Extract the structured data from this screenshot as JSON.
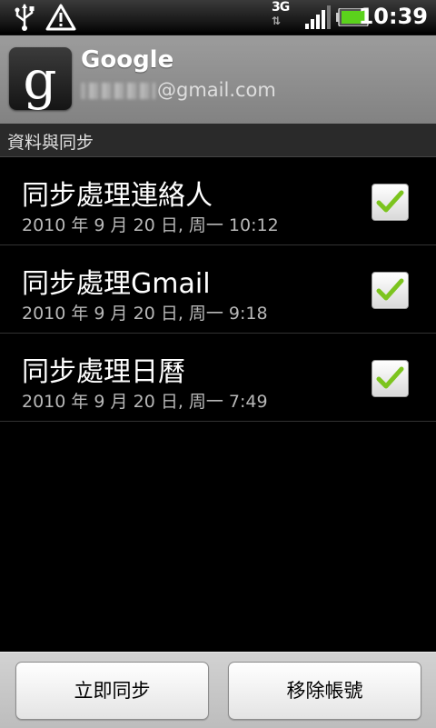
{
  "status_bar": {
    "time": "10:39",
    "network": "3G",
    "icons": [
      "usb-icon",
      "warning-icon",
      "signal-icon",
      "battery-icon"
    ]
  },
  "account": {
    "name": "Google",
    "email_visible": "@gmail.com",
    "icon": "google-g-icon"
  },
  "section": {
    "title": "資料與同步"
  },
  "sync_items": [
    {
      "label": "同步處理連絡人",
      "last_sync": "2010 年 9 月 20 日, 周一 10:12",
      "checked": true
    },
    {
      "label": "同步處理Gmail",
      "last_sync": "2010 年 9 月 20 日, 周一 9:18",
      "checked": true
    },
    {
      "label": "同步處理日曆",
      "last_sync": "2010 年 9 月 20 日, 周一 7:49",
      "checked": true
    }
  ],
  "buttons": {
    "sync_now": "立即同步",
    "remove_account": "移除帳號"
  },
  "colors": {
    "check_green": "#7cc41e",
    "header_gray": "#909090"
  }
}
